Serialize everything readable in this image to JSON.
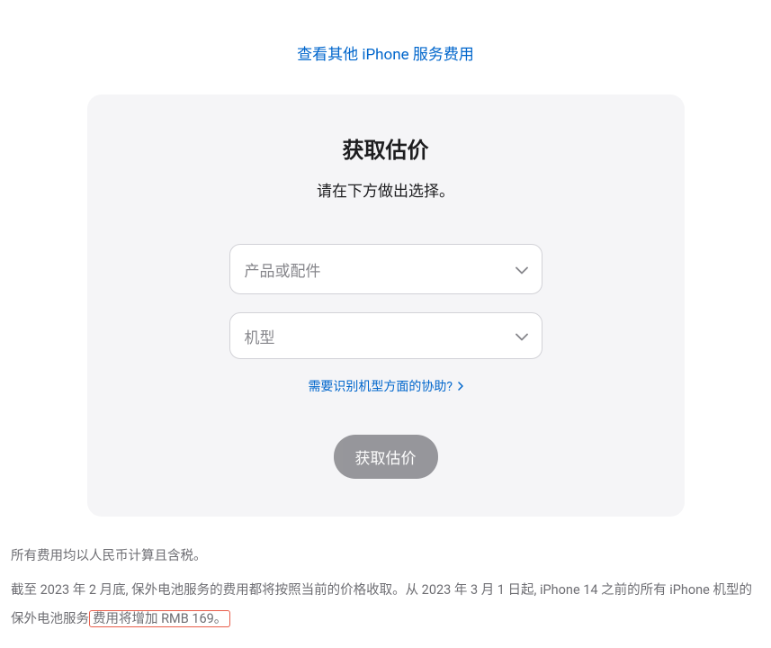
{
  "topLink": "查看其他 iPhone 服务费用",
  "card": {
    "title": "获取估价",
    "subtitle": "请在下方做出选择。",
    "select1_placeholder": "产品或配件",
    "select2_placeholder": "机型",
    "helpLink": "需要识别机型方面的协助?",
    "submit": "获取估价"
  },
  "footer": {
    "line1": "所有费用均以人民币计算且含税。",
    "line2_part1": "截至 2023 年 2 月底, 保外电池服务的费用都将按照当前的价格收取。从 2023 年 3 月 1 日起, iPhone 14 之前的所有 iPhone 机型的保外电池服务",
    "line2_highlight": "费用将增加 RMB 169。"
  }
}
